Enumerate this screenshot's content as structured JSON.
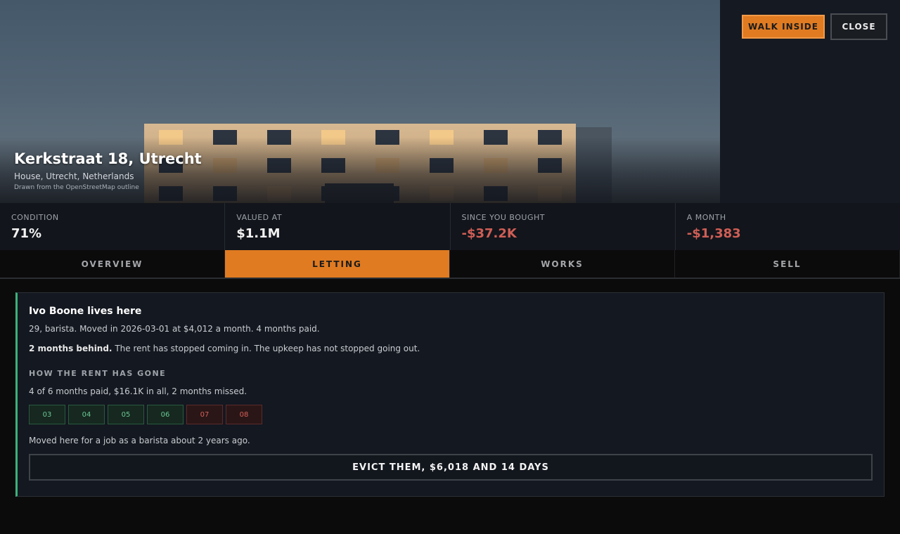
{
  "header": {
    "title": "Kerkstraat 18, Utrecht",
    "subtitle": "House, Utrecht, Netherlands",
    "source_note": "Drawn from the OpenStreetMap outline",
    "walk_label": "WALK INSIDE",
    "close_label": "CLOSE"
  },
  "stats": [
    {
      "label": "CONDITION",
      "value": "71%"
    },
    {
      "label": "VALUED AT",
      "value": "$1.1M"
    },
    {
      "label": "SINCE YOU BOUGHT",
      "value": "-$37.2K"
    },
    {
      "label": "A MONTH",
      "value": "-$1,383"
    }
  ],
  "tabs": [
    {
      "label": "OVERVIEW",
      "active": false
    },
    {
      "label": "LETTING",
      "active": true
    },
    {
      "label": "WORKS",
      "active": false
    },
    {
      "label": "SELL",
      "active": false
    }
  ],
  "tenant": {
    "title": "Ivo Boone lives here",
    "details": "29, barista. Moved in 2026-03-01 at $4,012 a month. 4 months paid.",
    "behind_bold": "2 months behind.",
    "behind_rest": " The rent has stopped coming in. The upkeep has not stopped going out.",
    "rent_heading": "HOW THE RENT HAS GONE",
    "rent_summary": "4 of 6 months paid, $16.1K in all, 2 months missed.",
    "months": [
      {
        "label": "03",
        "status": "paid"
      },
      {
        "label": "04",
        "status": "paid"
      },
      {
        "label": "05",
        "status": "paid"
      },
      {
        "label": "06",
        "status": "paid"
      },
      {
        "label": "07",
        "status": "missed"
      },
      {
        "label": "08",
        "status": "missed"
      }
    ],
    "backstory": "Moved here for a job as a barista about 2 years ago.",
    "evict_label": "EVICT THEM, $6,018 AND 14 DAYS"
  },
  "colors": {
    "accent": "#e07b22",
    "paid": "#6cc894",
    "missed": "#d4605a",
    "negative": "#cf5e56"
  }
}
